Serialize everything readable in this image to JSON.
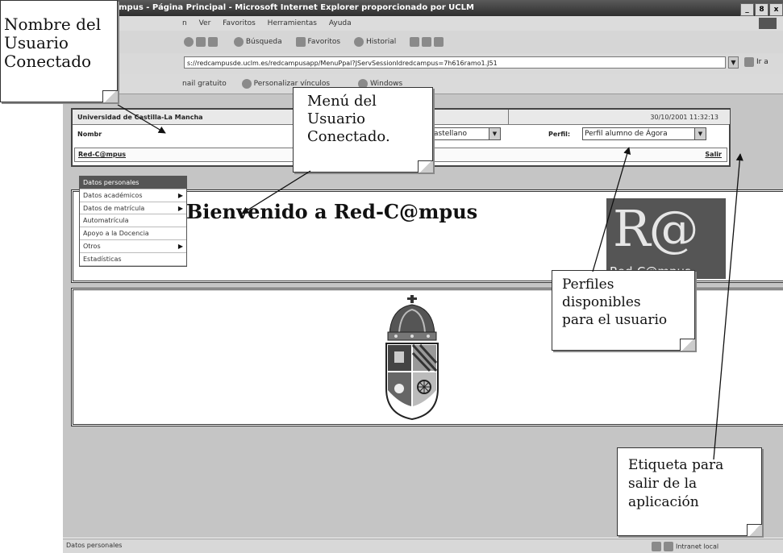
{
  "window": {
    "title": "Red-C@mpus - Página Principal - Microsoft Internet Explorer proporcionado por UCLM",
    "controls": [
      "_",
      "8",
      "x"
    ]
  },
  "menubar": {
    "items": [
      "n",
      "Ver",
      "Favoritos",
      "Herramientas",
      "Ayuda"
    ]
  },
  "toolbar": {
    "search": "Búsqueda",
    "favorites": "Favoritos",
    "history": "Historial"
  },
  "addressbar": {
    "url": "s://redcampusde.uclm.es/redcampusapp/MenuPpal?JServSessionIdredcampus=7h616ramo1.J51",
    "go_label": "Ir a"
  },
  "linksbar": {
    "items": [
      "nail gratuito",
      "Personalizar vínculos",
      "Windows"
    ]
  },
  "header": {
    "university": "Universidad de Castilla-La Mancha",
    "datetime": "30/10/2001 11:32:13",
    "name_label": "Nombr",
    "language": "astellano",
    "profile_label": "Perfil:",
    "profile_value": "Perfil alumno de Ágora",
    "site_link": "Red-C@mpus",
    "logout": "Salir"
  },
  "side_menu": {
    "items": [
      {
        "label": "Datos personales",
        "arrow": ""
      },
      {
        "label": "Datos académicos",
        "arrow": "▶"
      },
      {
        "label": "Datos de matrícula",
        "arrow": "▶"
      },
      {
        "label": "Automatrícula",
        "arrow": ""
      },
      {
        "label": "Apoyo a la Docencia",
        "arrow": ""
      },
      {
        "label": "Otros",
        "arrow": "▶"
      },
      {
        "label": "Estadísticas",
        "arrow": ""
      }
    ]
  },
  "welcome": {
    "title": "Bienvenido a Red-C@mpus",
    "logo_big": "R@",
    "logo_small": "Red-C@mpus"
  },
  "statusbar": {
    "text": "Datos personales",
    "zone": "Intranet local"
  },
  "callouts": {
    "user": [
      "Nombre del",
      "Usuario",
      "Conectado"
    ],
    "menu": [
      "Menú del",
      "Usuario",
      "Conectado."
    ],
    "profiles": [
      "Perfiles",
      "disponibles",
      "para el usuario"
    ],
    "exit": [
      "Etiqueta para",
      "salir de la",
      "aplicación"
    ]
  }
}
